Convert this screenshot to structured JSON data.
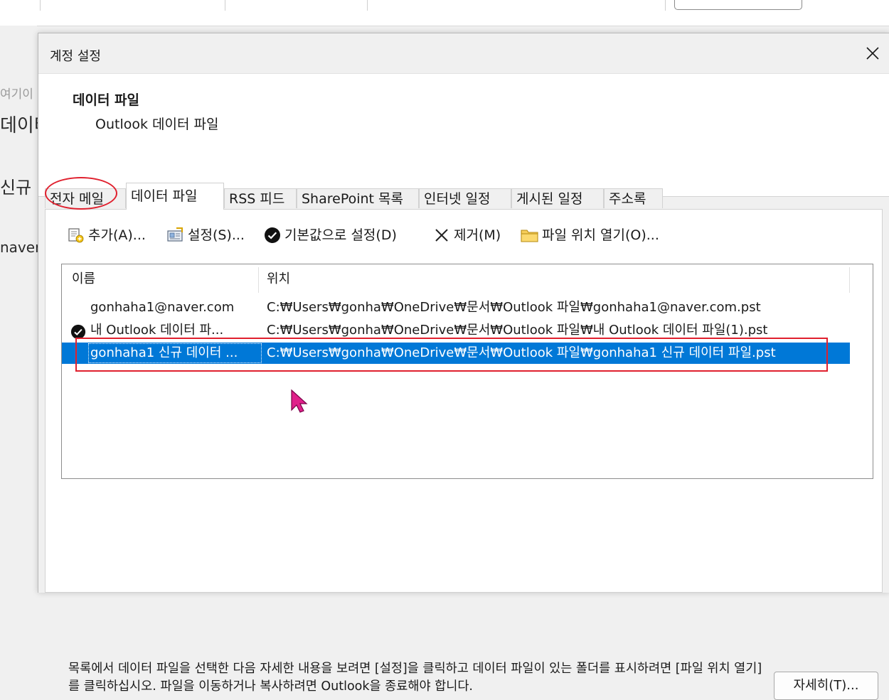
{
  "background": {
    "side_texts": [
      "여기이",
      "데이터",
      "신규 데",
      "naver"
    ]
  },
  "dialog": {
    "title": "계정 설정",
    "header": {
      "title": "데이터 파일",
      "subtitle": "Outlook 데이터 파일"
    },
    "tabs": [
      {
        "label": "전자 메일",
        "active": false
      },
      {
        "label": "데이터 파일",
        "active": true
      },
      {
        "label": "RSS 피드",
        "active": false
      },
      {
        "label": "SharePoint 목록",
        "active": false
      },
      {
        "label": "인터넷 일정",
        "active": false
      },
      {
        "label": "게시된 일정",
        "active": false
      },
      {
        "label": "주소록",
        "active": false
      }
    ],
    "toolbar": {
      "add": "추가(A)...",
      "settings": "설정(S)...",
      "set_default": "기본값으로 설정(D)",
      "remove": "제거(M)",
      "open_location": "파일 위치 열기(O)..."
    },
    "list": {
      "columns": [
        "이름",
        "위치"
      ],
      "rows": [
        {
          "name": "gonhaha1@naver.com",
          "path": "C:₩Users₩gonha₩OneDrive₩문서₩Outlook 파일₩gonhaha1@naver.com.pst",
          "default": false,
          "selected": false
        },
        {
          "name": "내 Outlook 데이터 파...",
          "path": "C:₩Users₩gonha₩OneDrive₩문서₩Outlook 파일₩내 Outlook 데이터 파일(1).pst",
          "default": true,
          "selected": false
        },
        {
          "name": "gonhaha1 신규 데이터 ...",
          "path": "C:₩Users₩gonha₩OneDrive₩문서₩Outlook 파일₩gonhaha1 신규 데이터 파일.pst",
          "default": false,
          "selected": true
        }
      ]
    },
    "description": "목록에서 데이터 파일을 선택한 다음 자세한 내용을 보려면 [설정]을 클릭하고 데이터 파일이 있는 폴더를 표시하려면 [파일 위치 열기]를 클릭하십시오. 파일을 이동하거나 복사하려면 Outlook을 종료해야 합니다.",
    "details_button": "자세히(T)..."
  },
  "colors": {
    "selection": "#0078d7",
    "annotation": "#e0202e",
    "cursor": "#e0208a"
  }
}
